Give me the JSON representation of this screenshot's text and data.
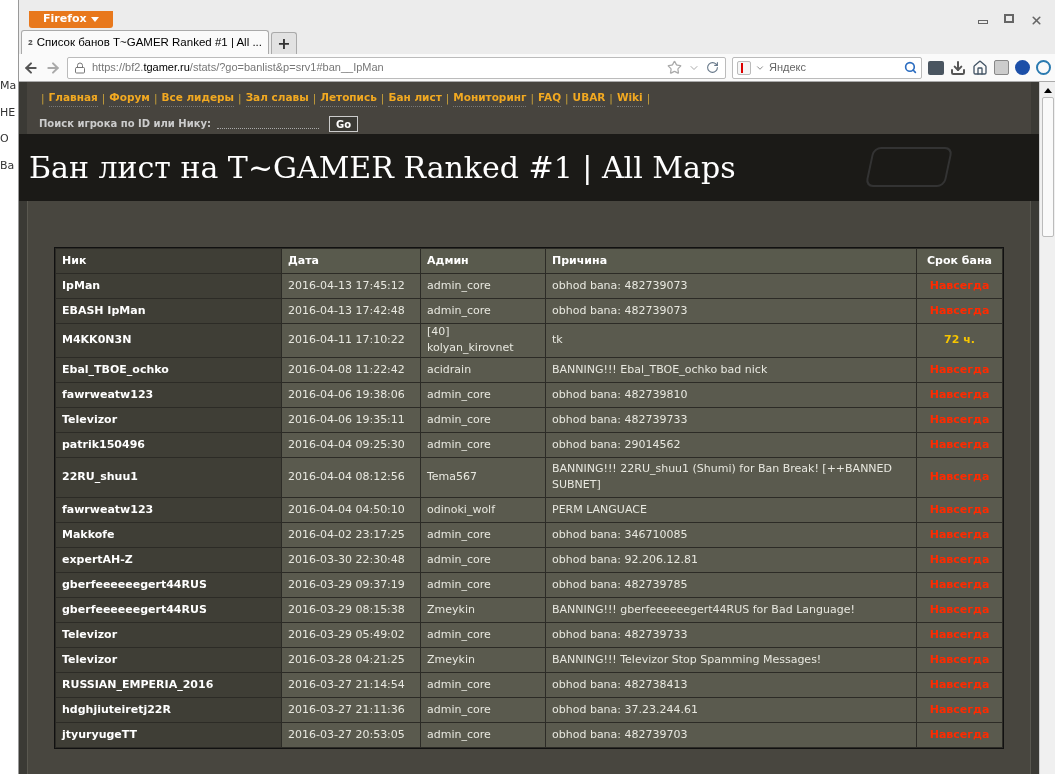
{
  "background_window": {
    "fragments": [
      "Ma",
      "НЕ",
      "О",
      "Ва"
    ]
  },
  "browser": {
    "menu_button": "Firefox",
    "tab": {
      "title": "Список банов T~GAMER Ranked #1 | All ...",
      "selected": true
    },
    "new_tab": "+",
    "url": {
      "prefix": "https://bf2.",
      "domain": "tgamer.ru",
      "path": "/stats/?go=banlist&p=srv1#ban__IpMan"
    },
    "search_placeholder": "Яндекс"
  },
  "nav": {
    "links": [
      "Главная",
      "Форум",
      "Все лидеры",
      "Зал славы",
      "Летопись",
      "Бан лист",
      "Мониторинг",
      "FAQ",
      "UBAR",
      "Wiki"
    ],
    "separator": "|",
    "search_label": "Поиск игрока по ID или Нику:",
    "search_button": "Go"
  },
  "page_title": "Бан лист на T~GAMER Ranked #1 | All Maps",
  "table": {
    "columns": [
      "Ник",
      "Дата",
      "Админ",
      "Причина",
      "Срок бана"
    ],
    "rows": [
      {
        "nick": "IpMan",
        "date": "2016-04-13 17:45:12",
        "admin": "admin_core",
        "reason": "obhod bana: 482739073",
        "term": "Навсегда",
        "kind": "permanent"
      },
      {
        "nick": "EBASH IpMan",
        "date": "2016-04-13 17:42:48",
        "admin": "admin_core",
        "reason": "obhod bana: 482739073",
        "term": "Навсегда",
        "kind": "permanent"
      },
      {
        "nick": "M4KK0N3N",
        "date": "2016-04-11 17:10:22",
        "admin": "[40] kolyan_kirovnet",
        "reason": "tk",
        "term": "72 ч.",
        "kind": "temporary"
      },
      {
        "nick": "Ebal_TBOE_ochko",
        "date": "2016-04-08 11:22:42",
        "admin": "acidrain",
        "reason": "BANNING!!! Ebal_TBOE_ochko bad nick",
        "term": "Навсегда",
        "kind": "permanent"
      },
      {
        "nick": "fawrweatw123",
        "date": "2016-04-06 19:38:06",
        "admin": "admin_core",
        "reason": "obhod bana: 482739810",
        "term": "Навсегда",
        "kind": "permanent"
      },
      {
        "nick": "Televizor",
        "date": "2016-04-06 19:35:11",
        "admin": "admin_core",
        "reason": "obhod bana: 482739733",
        "term": "Навсегда",
        "kind": "permanent"
      },
      {
        "nick": "patrik150496",
        "date": "2016-04-04 09:25:30",
        "admin": "admin_core",
        "reason": "obhod bana: 29014562",
        "term": "Навсегда",
        "kind": "permanent"
      },
      {
        "nick": "22RU_shuu1",
        "date": "2016-04-04 08:12:56",
        "admin": "Tema567",
        "reason": "BANNING!!! 22RU_shuu1 (Shumi) for Ban Break! [++BANNED SUBNET]",
        "term": "Навсегда",
        "kind": "permanent"
      },
      {
        "nick": "fawrweatw123",
        "date": "2016-04-04 04:50:10",
        "admin": "odinoki_wolf",
        "reason": "PERM LANGUACE",
        "term": "Навсегда",
        "kind": "permanent"
      },
      {
        "nick": "Makkofe",
        "date": "2016-04-02 23:17:25",
        "admin": "admin_core",
        "reason": "obhod bana: 346710085",
        "term": "Навсегда",
        "kind": "permanent"
      },
      {
        "nick": "expertAH-Z",
        "date": "2016-03-30 22:30:48",
        "admin": "admin_core",
        "reason": "obhod bana: 92.206.12.81",
        "term": "Навсегда",
        "kind": "permanent"
      },
      {
        "nick": "gberfeeeeeegert44RUS",
        "date": "2016-03-29 09:37:19",
        "admin": "admin_core",
        "reason": "obhod bana: 482739785",
        "term": "Навсегда",
        "kind": "permanent"
      },
      {
        "nick": "gberfeeeeeegert44RUS",
        "date": "2016-03-29 08:15:38",
        "admin": "Zmeykin",
        "reason": "BANNING!!! gberfeeeeeegert44RUS for Bad Language!",
        "term": "Навсегда",
        "kind": "permanent"
      },
      {
        "nick": "Televizor",
        "date": "2016-03-29 05:49:02",
        "admin": "admin_core",
        "reason": "obhod bana: 482739733",
        "term": "Навсегда",
        "kind": "permanent"
      },
      {
        "nick": "Televizor",
        "date": "2016-03-28 04:21:25",
        "admin": "Zmeykin",
        "reason": "BANNING!!! Televizor Stop Spamming Messages!",
        "term": "Навсегда",
        "kind": "permanent"
      },
      {
        "nick": "RUSSIAN_EMPERIA_2016",
        "date": "2016-03-27 21:14:54",
        "admin": "admin_core",
        "reason": "obhod bana: 482738413",
        "term": "Навсегда",
        "kind": "permanent"
      },
      {
        "nick": "hdghjiuteiretj22R",
        "date": "2016-03-27 21:11:36",
        "admin": "admin_core",
        "reason": "obhod bana: 37.23.244.61",
        "term": "Навсегда",
        "kind": "permanent"
      },
      {
        "nick": "jtyuryugeTT",
        "date": "2016-03-27 20:53:05",
        "admin": "admin_core",
        "reason": "obhod bana: 482739703",
        "term": "Навсегда",
        "kind": "permanent"
      }
    ]
  }
}
